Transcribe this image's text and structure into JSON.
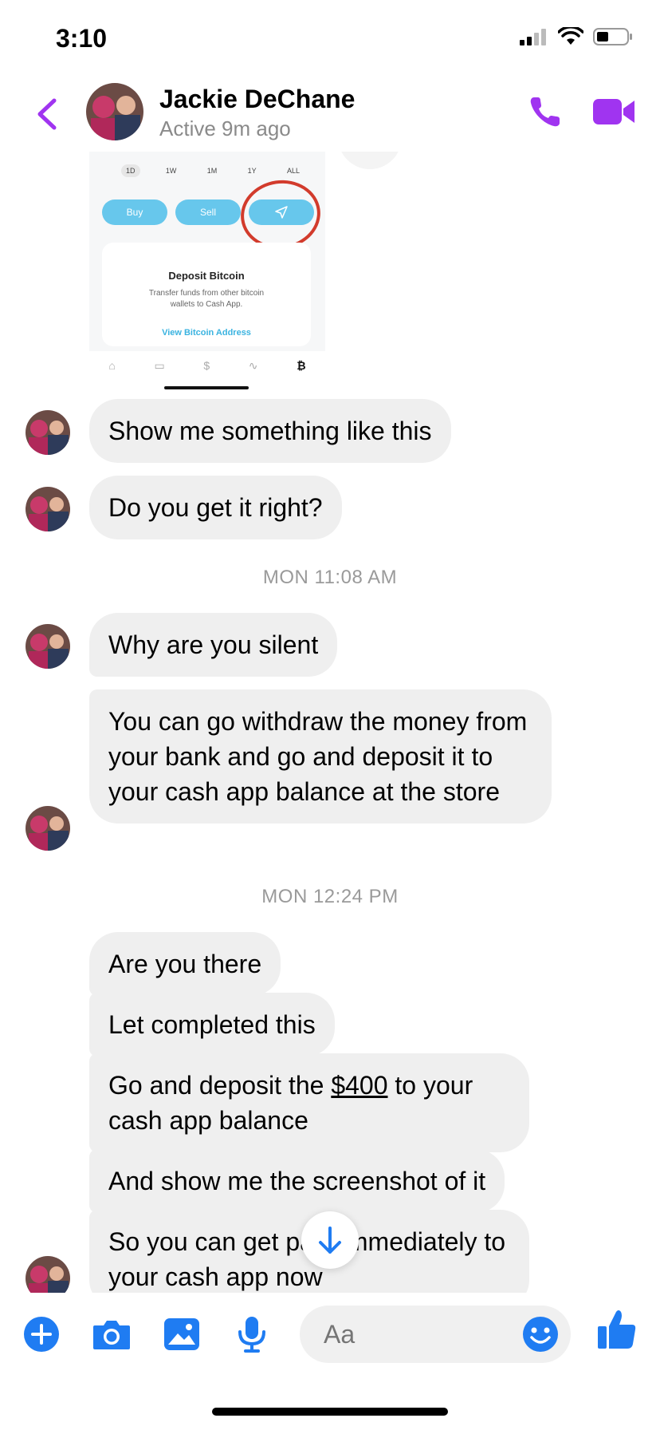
{
  "status_bar": {
    "time": "3:10"
  },
  "header": {
    "contact_name": "Jackie DeChane",
    "contact_status": "Active 9m ago"
  },
  "shared_image": {
    "timeframes": [
      "1D",
      "1W",
      "1M",
      "1Y",
      "ALL"
    ],
    "selected_timeframe": "1D",
    "buttons": [
      "Buy",
      "Sell"
    ],
    "deposit_title": "Deposit Bitcoin",
    "deposit_desc": "Transfer funds from other bitcoin wallets to Cash App.",
    "deposit_link": "View Bitcoin Address",
    "tabbar": [
      "⌂",
      "▭",
      "$",
      "∿",
      "₿"
    ]
  },
  "messages": {
    "m1": "Show me something like this",
    "m2": "Do you get it right?",
    "ts1": "MON 11:08 AM",
    "m3": "Why are you silent",
    "m4": "You can go withdraw the money from your bank and go and deposit it to your cash app balance at the store",
    "ts2": "MON 12:24 PM",
    "m5": "Are you there",
    "m6": "Let completed this",
    "m7_pre": "Go and deposit the ",
    "m7_amount": "$400",
    "m7_post": " to your cash app balance",
    "m8": "And show me the screenshot of it",
    "m9": "So you can get paid immediately to your cash app now"
  },
  "composer": {
    "placeholder": "Aa"
  },
  "colors": {
    "accent": "#a034f0",
    "messenger_blue": "#1f7cf2",
    "bubble": "#efefef"
  }
}
